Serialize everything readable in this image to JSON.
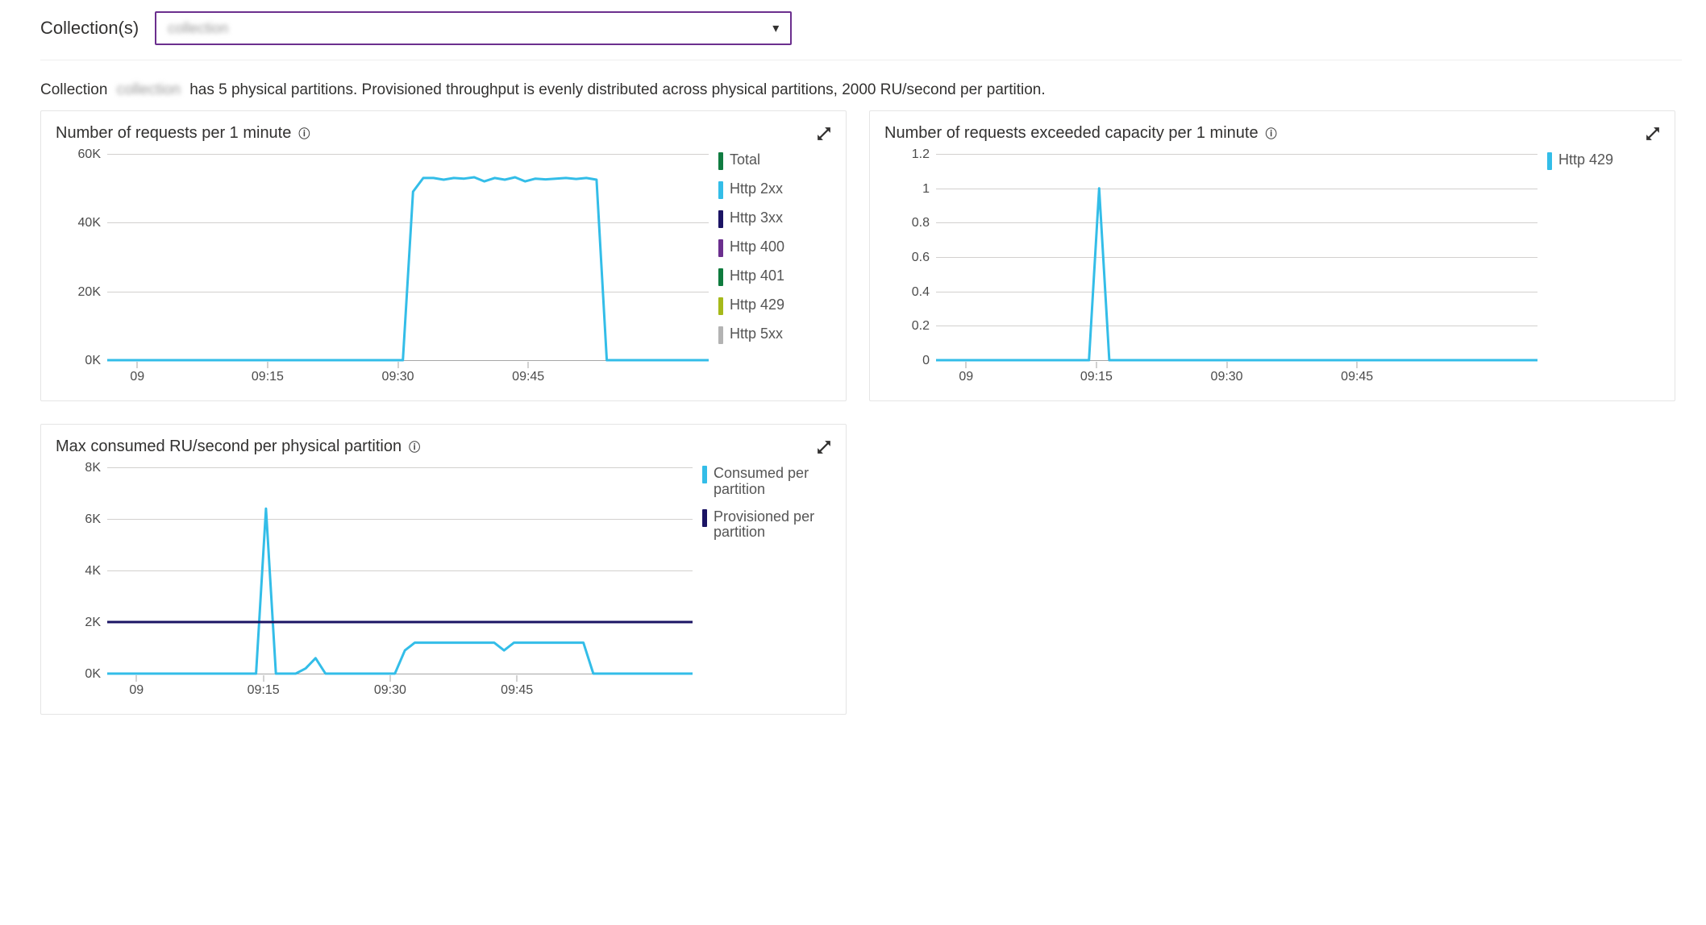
{
  "toolbar": {
    "label": "Collection(s)",
    "selected": "collection"
  },
  "info": {
    "prefix": "Collection",
    "redacted": "collection",
    "rest": "has 5 physical partitions. Provisioned throughput is evenly distributed across physical partitions, 2000 RU/second per partition."
  },
  "colors": {
    "total": "#107C41",
    "http2xx": "#33BDE8",
    "http3xx": "#1B1464",
    "http400": "#6B2F8E",
    "http401": "#0F7B3E",
    "http429": "#A6B91A",
    "http5xx": "#B3B3B3",
    "http429_panel2": "#33BDE8",
    "consumed": "#33BDE8",
    "provisioned": "#1B1464"
  },
  "panels": {
    "reqs": {
      "title": "Number of requests per 1 minute",
      "legend": [
        {
          "key": "total",
          "label": "Total"
        },
        {
          "key": "http2xx",
          "label": "Http 2xx"
        },
        {
          "key": "http3xx",
          "label": "Http 3xx"
        },
        {
          "key": "http400",
          "label": "Http 400"
        },
        {
          "key": "http401",
          "label": "Http 401"
        },
        {
          "key": "http429",
          "label": "Http 429"
        },
        {
          "key": "http5xx",
          "label": "Http 5xx"
        }
      ]
    },
    "exceeded": {
      "title": "Number of requests exceeded capacity per 1 minute",
      "legend": [
        {
          "key": "http429_panel2",
          "label": "Http 429"
        }
      ]
    },
    "ru": {
      "title": "Max consumed RU/second per physical partition",
      "legend": [
        {
          "key": "consumed",
          "label": "Consumed per partition"
        },
        {
          "key": "provisioned",
          "label": "Provisioned per partition"
        }
      ]
    }
  },
  "chart_data": [
    {
      "id": "reqs",
      "type": "line",
      "title": "Number of requests per 1 minute",
      "x_ticks": [
        "09",
        "09:15",
        "09:30",
        "09:45"
      ],
      "ylim": [
        0,
        60000
      ],
      "y_ticks": [
        0,
        20000,
        40000,
        60000
      ],
      "y_tick_labels": [
        "0K",
        "20K",
        "40K",
        "60K"
      ],
      "x": [
        0,
        1,
        2,
        3,
        4,
        5,
        6,
        7,
        8,
        9,
        10,
        11,
        12,
        13,
        14,
        15,
        16,
        17,
        18,
        19,
        20,
        21,
        22,
        23,
        24,
        25,
        26,
        27,
        28,
        29,
        30,
        31,
        32,
        33,
        34,
        35,
        36,
        37,
        38,
        39,
        40,
        41,
        42,
        43,
        44,
        45,
        46,
        47,
        48,
        49,
        50,
        51,
        52,
        53,
        54,
        55,
        56,
        57,
        58,
        59
      ],
      "x_range": [
        0,
        59
      ],
      "series": [
        {
          "name": "Http 2xx",
          "color_key": "http2xx",
          "values": [
            0,
            0,
            0,
            0,
            0,
            0,
            0,
            0,
            0,
            0,
            0,
            0,
            0,
            0,
            0,
            0,
            0,
            0,
            0,
            0,
            0,
            0,
            0,
            0,
            0,
            0,
            0,
            0,
            0,
            0,
            49000,
            53000,
            53000,
            52500,
            53000,
            52800,
            53200,
            52000,
            53000,
            52500,
            53200,
            52000,
            52800,
            52600,
            52800,
            53000,
            52700,
            53000,
            52500,
            0,
            0,
            0,
            0,
            0,
            0,
            0,
            0,
            0,
            0,
            0
          ]
        }
      ]
    },
    {
      "id": "exceeded",
      "type": "line",
      "title": "Number of requests exceeded capacity per 1 minute",
      "x_ticks": [
        "09",
        "09:15",
        "09:30",
        "09:45"
      ],
      "ylim": [
        0,
        1.2
      ],
      "y_ticks": [
        0,
        0.2,
        0.4,
        0.6,
        0.8,
        1,
        1.2
      ],
      "y_tick_labels": [
        "0",
        "0.2",
        "0.4",
        "0.6",
        "0.8",
        "1",
        "1.2"
      ],
      "x": [
        0,
        1,
        2,
        3,
        4,
        5,
        6,
        7,
        8,
        9,
        10,
        11,
        12,
        13,
        14,
        15,
        16,
        17,
        18,
        19,
        20,
        21,
        22,
        23,
        24,
        25,
        26,
        27,
        28,
        29,
        30,
        31,
        32,
        33,
        34,
        35,
        36,
        37,
        38,
        39,
        40,
        41,
        42,
        43,
        44,
        45,
        46,
        47,
        48,
        49,
        50,
        51,
        52,
        53,
        54,
        55,
        56,
        57,
        58,
        59
      ],
      "x_range": [
        0,
        59
      ],
      "series": [
        {
          "name": "Http 429",
          "color_key": "http429_panel2",
          "values": [
            0,
            0,
            0,
            0,
            0,
            0,
            0,
            0,
            0,
            0,
            0,
            0,
            0,
            0,
            0,
            0,
            1,
            0,
            0,
            0,
            0,
            0,
            0,
            0,
            0,
            0,
            0,
            0,
            0,
            0,
            0,
            0,
            0,
            0,
            0,
            0,
            0,
            0,
            0,
            0,
            0,
            0,
            0,
            0,
            0,
            0,
            0,
            0,
            0,
            0,
            0,
            0,
            0,
            0,
            0,
            0,
            0,
            0,
            0,
            0
          ]
        }
      ]
    },
    {
      "id": "ru",
      "type": "line",
      "title": "Max consumed RU/second per physical partition",
      "x_ticks": [
        "09",
        "09:15",
        "09:30",
        "09:45"
      ],
      "ylim": [
        0,
        8000
      ],
      "y_ticks": [
        0,
        2000,
        4000,
        6000,
        8000
      ],
      "y_tick_labels": [
        "0K",
        "2K",
        "4K",
        "6K",
        "8K"
      ],
      "x": [
        0,
        1,
        2,
        3,
        4,
        5,
        6,
        7,
        8,
        9,
        10,
        11,
        12,
        13,
        14,
        15,
        16,
        17,
        18,
        19,
        20,
        21,
        22,
        23,
        24,
        25,
        26,
        27,
        28,
        29,
        30,
        31,
        32,
        33,
        34,
        35,
        36,
        37,
        38,
        39,
        40,
        41,
        42,
        43,
        44,
        45,
        46,
        47,
        48,
        49,
        50,
        51,
        52,
        53,
        54,
        55,
        56,
        57,
        58,
        59
      ],
      "x_range": [
        0,
        59
      ],
      "series": [
        {
          "name": "Consumed per partition",
          "color_key": "consumed",
          "values": [
            0,
            0,
            0,
            0,
            0,
            0,
            0,
            0,
            0,
            0,
            0,
            0,
            0,
            0,
            0,
            0,
            6400,
            0,
            0,
            0,
            200,
            600,
            0,
            0,
            0,
            0,
            0,
            0,
            0,
            0,
            900,
            1200,
            1200,
            1200,
            1200,
            1200,
            1200,
            1200,
            1200,
            1200,
            900,
            1200,
            1200,
            1200,
            1200,
            1200,
            1200,
            1200,
            1200,
            0,
            0,
            0,
            0,
            0,
            0,
            0,
            0,
            0,
            0,
            0
          ]
        },
        {
          "name": "Provisioned per partition",
          "color_key": "provisioned",
          "values": [
            2000,
            2000,
            2000,
            2000,
            2000,
            2000,
            2000,
            2000,
            2000,
            2000,
            2000,
            2000,
            2000,
            2000,
            2000,
            2000,
            2000,
            2000,
            2000,
            2000,
            2000,
            2000,
            2000,
            2000,
            2000,
            2000,
            2000,
            2000,
            2000,
            2000,
            2000,
            2000,
            2000,
            2000,
            2000,
            2000,
            2000,
            2000,
            2000,
            2000,
            2000,
            2000,
            2000,
            2000,
            2000,
            2000,
            2000,
            2000,
            2000,
            2000,
            2000,
            2000,
            2000,
            2000,
            2000,
            2000,
            2000,
            2000,
            2000,
            2000
          ]
        }
      ]
    }
  ]
}
